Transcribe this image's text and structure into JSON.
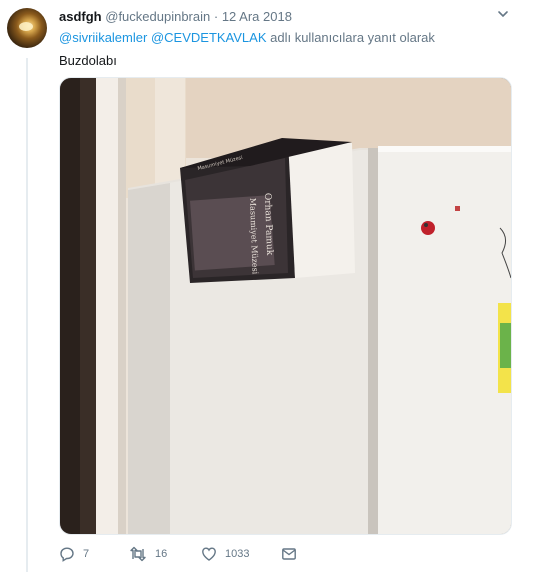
{
  "tweet": {
    "display_name": "asdfgh",
    "handle": "@fuckedupinbrain",
    "separator": "·",
    "date": "12 Ara 2018",
    "reply_to": {
      "mention_1": "@sivriikalemler",
      "mention_2": "@CEVDETKAVLAK",
      "suffix": "adlı kullanıcılara yanıt olarak"
    },
    "text": "Buzdolabı",
    "media": {
      "book": {
        "author": "Orhan Pamuk",
        "title": "Masumiyet Müzesi",
        "spine": "Masumiyet Müzesi"
      }
    }
  },
  "actions": {
    "reply_count": "7",
    "retweet_count": "16",
    "like_count": "1033"
  },
  "icons": {
    "reply": "reply-icon",
    "retweet": "retweet-icon",
    "like": "heart-icon",
    "dm": "mail-icon",
    "menu": "chevron-down-icon"
  },
  "colors": {
    "link": "#1b95e0",
    "secondary_text": "#657786",
    "border": "#e6ecf0"
  }
}
